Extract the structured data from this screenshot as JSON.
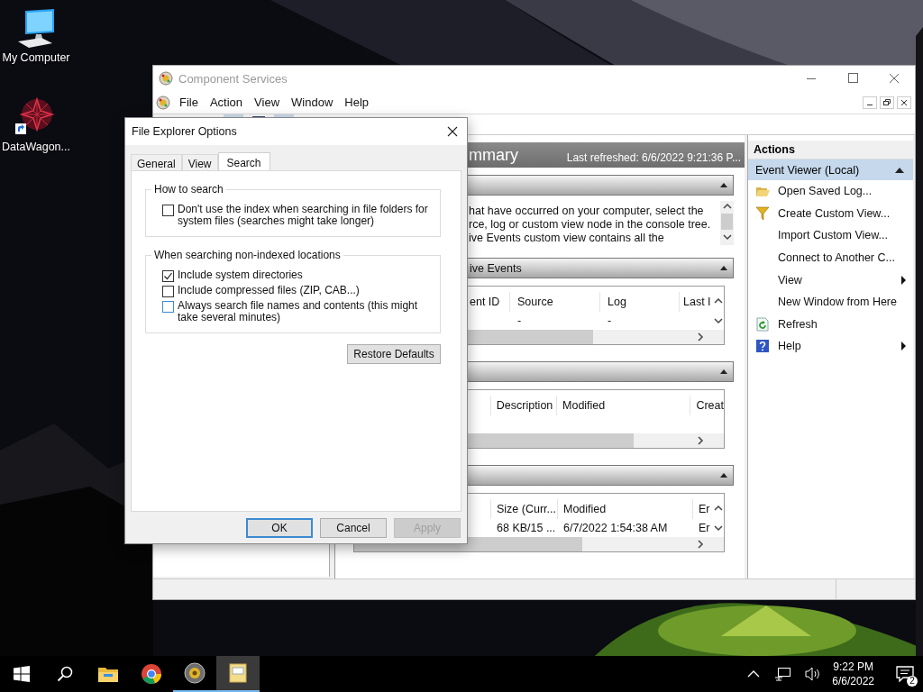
{
  "desktop_icons": [
    {
      "label": "My Computer",
      "kind": "computer"
    },
    {
      "label": "DataWagon...",
      "kind": "app"
    }
  ],
  "main_window": {
    "title": "Component Services",
    "menu": [
      "File",
      "Action",
      "View",
      "Window",
      "Help"
    ],
    "summary": {
      "title": "mmary",
      "last_refreshed": "Last refreshed: 6/6/2022 9:21:36 P..."
    },
    "sections": [
      {
        "kind": "text",
        "lines": [
          "hat have occurred on your computer, select the",
          "rce, log or custom view node in the console tree.",
          "ive Events custom view contains all the"
        ]
      },
      {
        "kind": "table",
        "title": "ive Events",
        "columns": [
          "ent ID",
          "Source",
          "Log",
          "Last I"
        ],
        "rows": [
          [
            null,
            "-",
            "-",
            null
          ]
        ]
      },
      {
        "kind": "table",
        "columns": [
          null,
          "Description",
          "Modified",
          "Creat"
        ]
      },
      {
        "kind": "table",
        "columns": [
          null,
          "Size (Curr...",
          "Modified",
          "Er"
        ],
        "rows": [
          [
            null,
            "68 KB/15 ...",
            "6/7/2022 1:54:38 AM",
            "Er"
          ]
        ]
      }
    ],
    "actions": {
      "title": "Actions",
      "group": {
        "label": "Event Viewer (Local)",
        "selected": true,
        "expanded": true
      },
      "items": [
        {
          "label": "Open Saved Log...",
          "kind": "open",
          "submenu": false
        },
        {
          "label": "Create Custom View...",
          "kind": "filter",
          "submenu": false
        },
        {
          "label": "Import Custom View...",
          "kind": "plain",
          "submenu": false
        },
        {
          "label": "Connect to Another C...",
          "kind": "plain",
          "submenu": false
        },
        {
          "label": "View",
          "kind": "plain",
          "submenu": true
        },
        {
          "label": "New Window from Here",
          "kind": "plain",
          "submenu": false
        },
        {
          "label": "Refresh",
          "kind": "refresh",
          "submenu": false
        },
        {
          "label": "Help",
          "kind": "help",
          "submenu": true
        }
      ]
    }
  },
  "dialog": {
    "title": "File Explorer Options",
    "tabs": [
      {
        "label": "General",
        "selected": false
      },
      {
        "label": "View",
        "selected": false
      },
      {
        "label": "Search",
        "selected": true
      }
    ],
    "groups": [
      {
        "title": "How to search",
        "options": [
          {
            "label": "Don't use the index when searching in file folders for system files (searches might take longer)",
            "checked": false,
            "hover": false
          }
        ]
      },
      {
        "title": "When searching non-indexed locations",
        "options": [
          {
            "label": "Include system directories",
            "checked": true,
            "hover": false
          },
          {
            "label": "Include compressed files (ZIP, CAB...)",
            "checked": false,
            "hover": false
          },
          {
            "label": "Always search file names and contents (this might take several minutes)",
            "checked": false,
            "hover": true
          }
        ]
      }
    ],
    "restore_button": "Restore Defaults",
    "buttons": [
      {
        "label": "OK",
        "default": true,
        "disabled": false
      },
      {
        "label": "Cancel",
        "default": false,
        "disabled": false
      },
      {
        "label": "Apply",
        "default": false,
        "disabled": true
      }
    ]
  },
  "taskbar": {
    "items": [
      {
        "kind": "start",
        "running": false,
        "active": false
      },
      {
        "kind": "search",
        "running": false,
        "active": false
      },
      {
        "kind": "files",
        "running": false,
        "active": false
      },
      {
        "kind": "browser",
        "running": false,
        "active": false
      },
      {
        "kind": "services",
        "running": true,
        "active": false
      },
      {
        "kind": "notes",
        "running": true,
        "active": true
      }
    ],
    "time": "9:22 PM",
    "date": "6/6/2022",
    "notifications": "2"
  }
}
